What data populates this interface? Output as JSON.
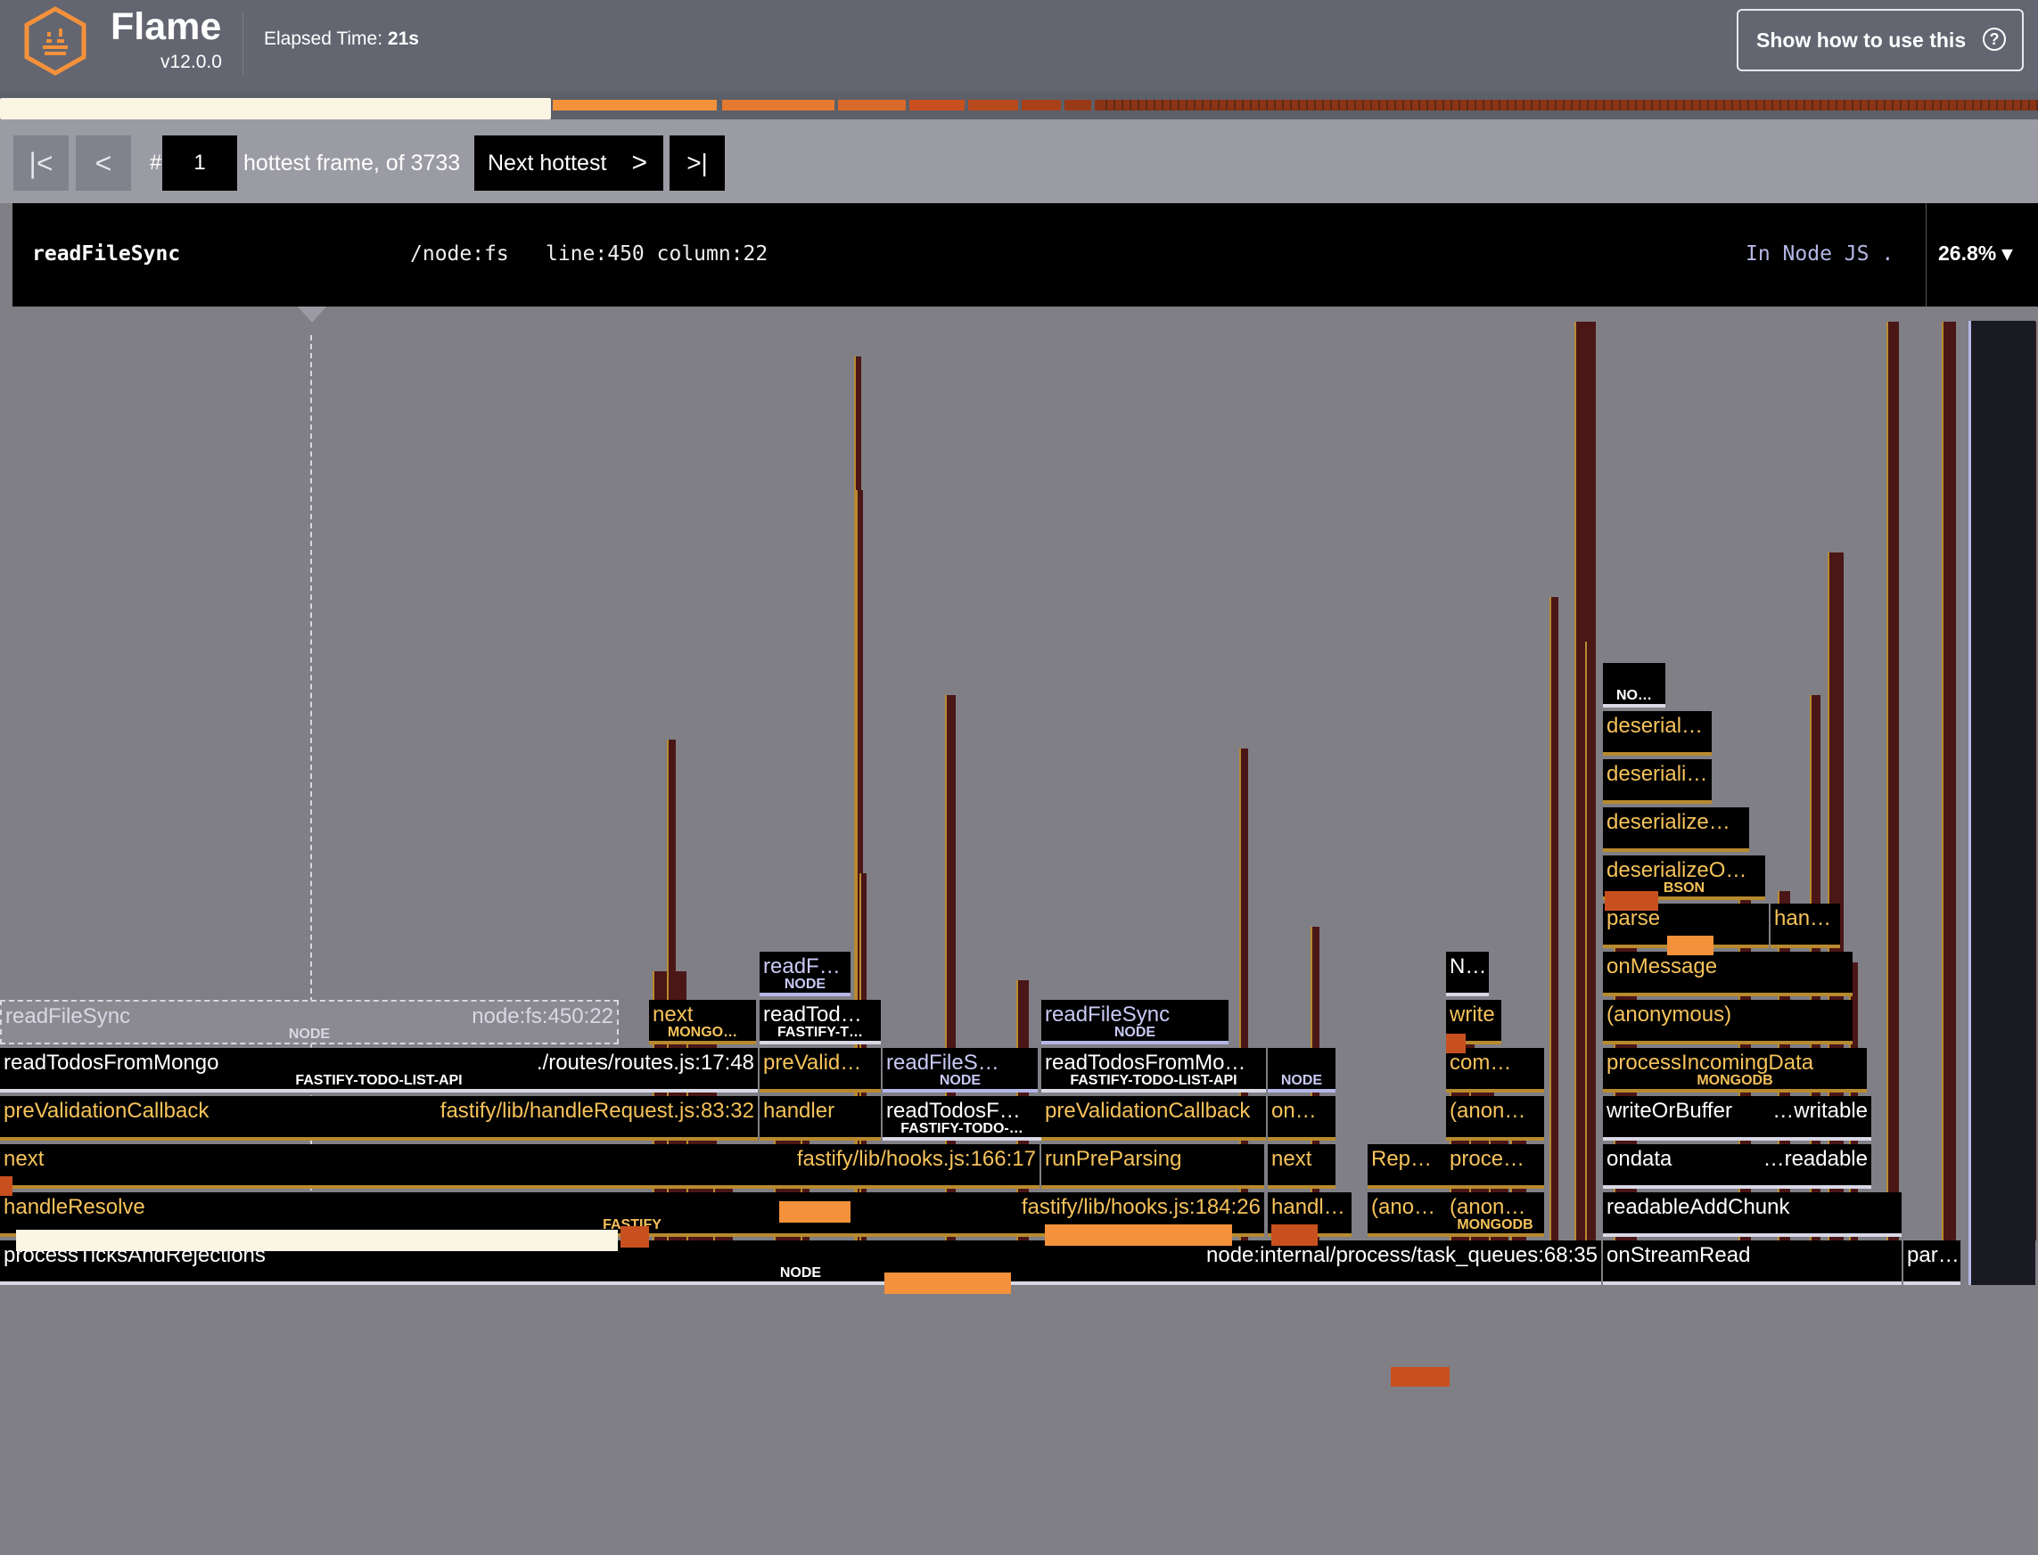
{
  "app": {
    "title": "Flame",
    "version": "v12.0.0",
    "elapsed_label": "Elapsed Time:",
    "elapsed_value": "21s",
    "help_label": "Show how to use this",
    "help_icon": "question-circle-icon"
  },
  "colors": {
    "header_bg": "#636570",
    "toolbar_bg": "#9b9ca3",
    "flame_bg": "#7f7f85",
    "frame_bg": "#000000",
    "app_text": "#f6c25a",
    "node_text": "#ffffff",
    "node_dim_text": "#c9c9f5",
    "hot_orange": "#f4913b",
    "hot_red": "#c8501f",
    "selected_frame": "#fbf6e4"
  },
  "navigation": {
    "first_icon": "skip-to-first-icon",
    "prev_icon": "chevron-left-icon",
    "hash": "#",
    "frame_number": "1",
    "frame_of_text": "hottest frame, of 3733",
    "next_label": "Next hottest",
    "next_icon": "chevron-right-icon",
    "last_icon": "skip-to-last-icon"
  },
  "selected": {
    "name": "readFileSync",
    "file": "/node:fs",
    "location": "line:450 column:22",
    "type": "In Node JS .",
    "percent": "26.8%",
    "percent_icon": "caret-down-icon"
  },
  "frames": [
    {
      "name": "processTicksAndRejections",
      "path": "node:internal/process/task_queues:68:35",
      "tag": "NODE"
    },
    {
      "name": "onStreamRead",
      "path": "",
      "tag": ""
    },
    {
      "name": "par…",
      "path": "",
      "tag": ""
    },
    {
      "name": "handleResolve",
      "path": "fastify/lib/hooks.js:184:26",
      "tag": "FASTIFY"
    },
    {
      "name": "handl…",
      "path": "",
      "tag": ""
    },
    {
      "name": "(ano…",
      "path": "",
      "tag": ""
    },
    {
      "name": "(anon…",
      "path": "",
      "tag": "MONGODB"
    },
    {
      "name": "readableAddChunk",
      "path": "",
      "tag": ""
    },
    {
      "name": "next",
      "path": "fastify/lib/hooks.js:166:17",
      "tag": ""
    },
    {
      "name": "runPreParsing",
      "path": "",
      "tag": ""
    },
    {
      "name": "next",
      "path": "",
      "tag": ""
    },
    {
      "name": "Rep…",
      "path": "",
      "tag": ""
    },
    {
      "name": "proce…",
      "path": "",
      "tag": ""
    },
    {
      "name": "ondata",
      "path": "…readable",
      "tag": ""
    },
    {
      "name": "preValidationCallback",
      "path": "fastify/lib/handleRequest.js:83:32",
      "tag": ""
    },
    {
      "name": "handler",
      "path": "",
      "tag": ""
    },
    {
      "name": "readTodosF…",
      "path": "",
      "tag": "FASTIFY-TODO-…"
    },
    {
      "name": "preValidationCallback",
      "path": "",
      "tag": ""
    },
    {
      "name": "on…",
      "path": "",
      "tag": ""
    },
    {
      "name": "(anon…",
      "path": "",
      "tag": ""
    },
    {
      "name": "writeOrBuffer",
      "path": "…writable",
      "tag": ""
    },
    {
      "name": "readTodosFromMongo",
      "path": "./routes/routes.js:17:48",
      "tag": "FASTIFY-TODO-LIST-API"
    },
    {
      "name": "preValid…",
      "path": "",
      "tag": ""
    },
    {
      "name": "readFileS…",
      "path": "",
      "tag": "NODE"
    },
    {
      "name": "readTodosFromMo…",
      "path": "",
      "tag": "FASTIFY-TODO-LIST-API"
    },
    {
      "name": "",
      "path": "",
      "tag": "NODE"
    },
    {
      "name": "com…",
      "path": "",
      "tag": ""
    },
    {
      "name": "processIncomingData",
      "path": "",
      "tag": "MONGODB"
    },
    {
      "name": "readFileSync",
      "path": "node:fs:450:22",
      "tag": "NODE"
    },
    {
      "name": "next",
      "path": "",
      "tag": "MONGO…"
    },
    {
      "name": "readTod…",
      "path": "",
      "tag": "FASTIFY-T…"
    },
    {
      "name": "readFileSync",
      "path": "",
      "tag": "NODE"
    },
    {
      "name": "write",
      "path": "",
      "tag": ""
    },
    {
      "name": "(anonymous)",
      "path": "",
      "tag": ""
    },
    {
      "name": "readF…",
      "path": "",
      "tag": "NODE"
    },
    {
      "name": "onMessage",
      "path": "",
      "tag": ""
    },
    {
      "name": "N…",
      "path": "",
      "tag": ""
    },
    {
      "name": "parse",
      "path": "",
      "tag": ""
    },
    {
      "name": "han…",
      "path": "",
      "tag": ""
    },
    {
      "name": "deserializeO…",
      "path": "",
      "tag": "BSON"
    },
    {
      "name": "deserialize…",
      "path": "",
      "tag": ""
    },
    {
      "name": "deseriali…",
      "path": "",
      "tag": ""
    },
    {
      "name": "deserial…",
      "path": "",
      "tag": ""
    },
    {
      "name": "",
      "path": "",
      "tag": "NO…"
    }
  ]
}
